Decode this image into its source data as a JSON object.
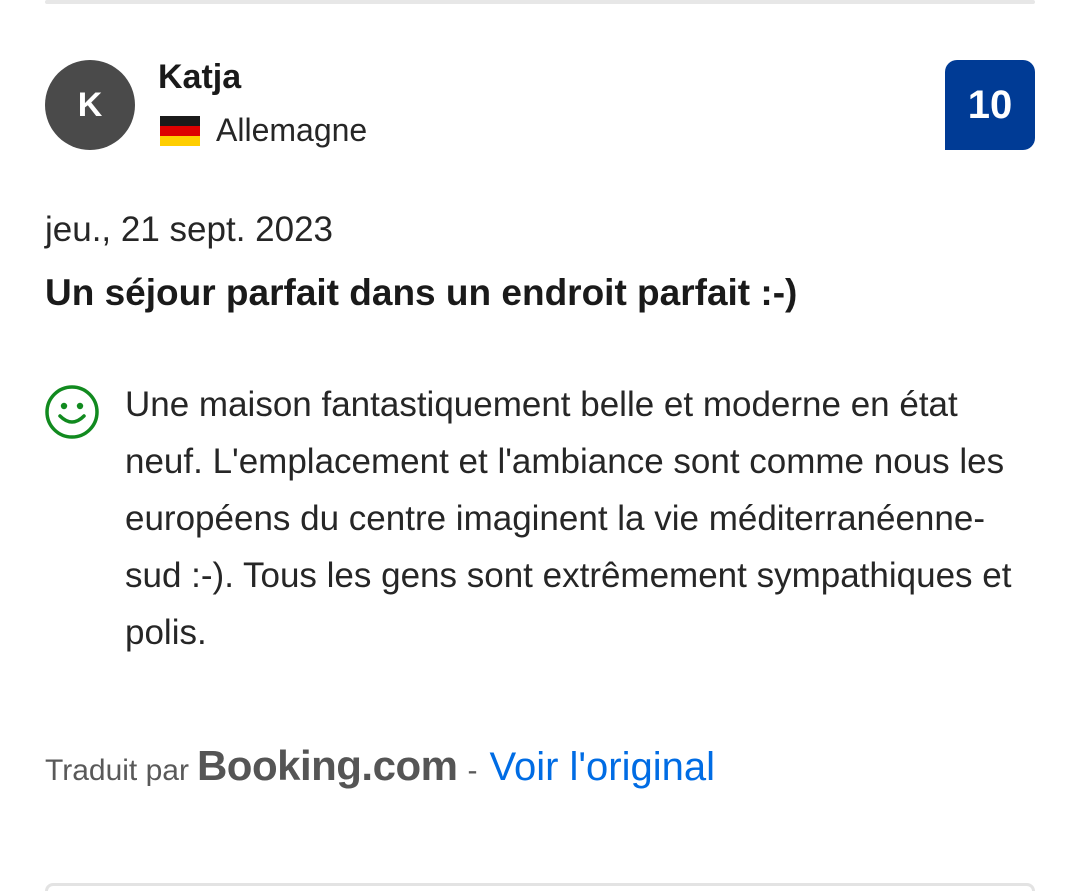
{
  "reviewer": {
    "initial": "K",
    "name": "Katja",
    "country": "Allemagne",
    "flag_icon": "germany-flag-icon",
    "flag_colors": [
      "#1a1a1a",
      "#dd0000",
      "#ffce00"
    ],
    "avatar_color": "#4a4a4a"
  },
  "score": {
    "value": "10",
    "color": "#003b95"
  },
  "review": {
    "date": "jeu., 21 sept. 2023",
    "title": "Un séjour parfait dans un endroit parfait :-)",
    "positive_icon": "smile-icon",
    "positive_color": "#118a1f",
    "positive_text": "Une maison fantastiquement belle et moderne en état neuf. L'emplacement et l'ambiance sont comme nous les européens du centre imaginent la vie méditerranéenne-sud :-). Tous les gens sont extrêmement sympathiques et polis."
  },
  "footer": {
    "translated_by": "Traduit par",
    "brand": "Booking.com",
    "separator": "-",
    "link_label": "Voir l'original",
    "link_color": "#006ce4"
  }
}
